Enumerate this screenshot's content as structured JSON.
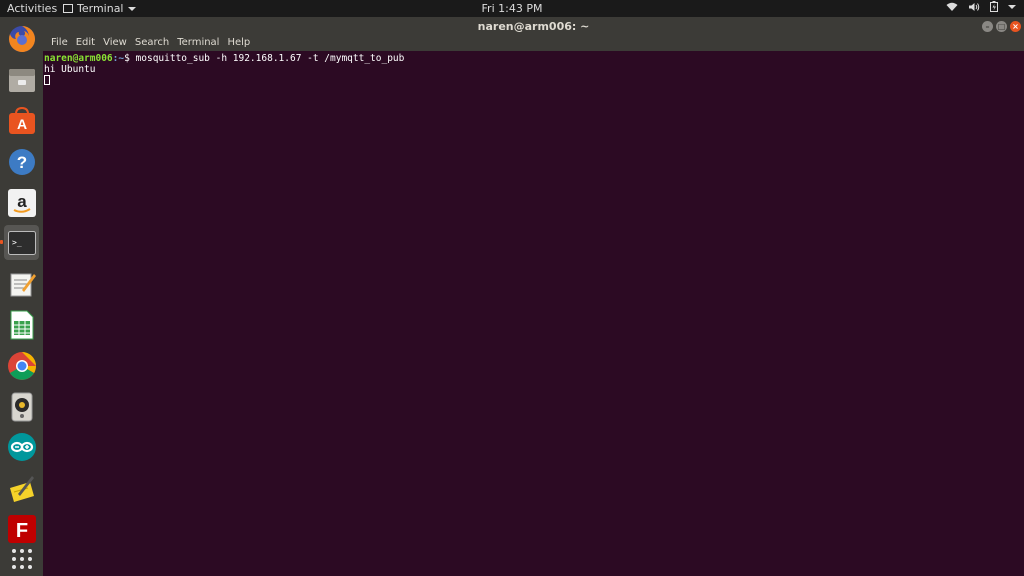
{
  "topbar": {
    "activities": "Activities",
    "app_menu": "Terminal",
    "clock": "Fri  1:43 PM"
  },
  "dock": {
    "items": [
      {
        "name": "firefox-icon"
      },
      {
        "name": "files-icon"
      },
      {
        "name": "software-center-icon"
      },
      {
        "name": "help-icon"
      },
      {
        "name": "amazon-icon"
      },
      {
        "name": "terminal-icon",
        "active": true
      },
      {
        "name": "text-editor-icon"
      },
      {
        "name": "spreadsheet-icon"
      },
      {
        "name": "chrome-icon"
      },
      {
        "name": "speaker-app-icon"
      },
      {
        "name": "arduino-icon"
      },
      {
        "name": "notes-icon"
      },
      {
        "name": "filezilla-icon"
      },
      {
        "name": "show-applications-icon"
      }
    ]
  },
  "window": {
    "title": "naren@arm006: ~",
    "menu": [
      "File",
      "Edit",
      "View",
      "Search",
      "Terminal",
      "Help"
    ],
    "buttons": {
      "minimize": "–",
      "maximize": "□",
      "close": "×"
    }
  },
  "terminal": {
    "prompt_user": "naren@arm006",
    "prompt_path": ":~",
    "prompt_symbol": "$",
    "command": " mosquitto_sub -h 192.168.1.67 -t /mymqtt_to_pub",
    "output": "hi Ubuntu"
  },
  "colors": {
    "terminal_bg": "#2c0a23",
    "accent": "#e95420",
    "prompt_user": "#8ae234",
    "prompt_path": "#729fcf"
  }
}
